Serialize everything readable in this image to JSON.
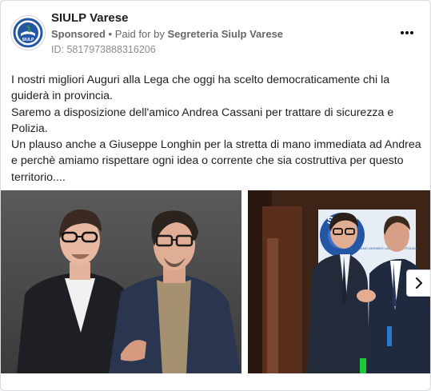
{
  "post": {
    "page_name": "SIULP Varese",
    "sponsored": "Sponsored",
    "separator": "•",
    "paid_for_by": "Paid for by",
    "payer": "Segreteria Siulp Varese",
    "ad_id": "ID: 5817973888316206",
    "avatar_text": "SIULP",
    "body_lines": [
      "I nostri migliori Auguri alla Lega che oggi ha scelto democraticamente chi la guiderà in provincia.",
      "Saremo a disposizione dell'amico Andrea Cassani per trattare di sicurezza e Polizia.",
      "Un plauso anche a Giuseppe Longhin per la stretta di mano immediata ad Andrea e perchè amiamo rispettare ogni idea o corrente che sia costruttiva per questo territorio...."
    ]
  },
  "media": {
    "banner_text": "SIULP",
    "banner_sub": "SINDACATO ITALIANO UNITARIO LAVORATORI POLIZIA",
    "icons": [
      "more-options-icon",
      "chevron-right-icon"
    ]
  },
  "colors": {
    "text": "#1c1e21",
    "secondary": "#65676b",
    "logo_blue": "#2456a6"
  }
}
